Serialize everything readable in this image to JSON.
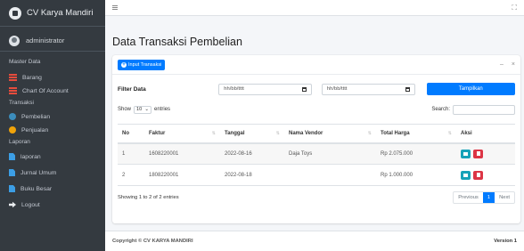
{
  "sidebar": {
    "brand": "CV Karya Mandiri",
    "user": "administrator",
    "sections": [
      {
        "header": "Master Data",
        "items": [
          {
            "label": "Barang",
            "icon": "table-icon"
          },
          {
            "label": "Chart Of Account",
            "icon": "table-icon"
          }
        ]
      },
      {
        "header": "Transaksi",
        "items": [
          {
            "label": "Pembelian",
            "icon": "circle-icon"
          },
          {
            "label": "Penjualan",
            "icon": "circle-icon"
          }
        ]
      },
      {
        "header": "Laporan",
        "items": [
          {
            "label": "laporan",
            "icon": "file-icon"
          },
          {
            "label": "Jurnal Umum",
            "icon": "file-icon"
          },
          {
            "label": "Buku Besar",
            "icon": "file-icon"
          }
        ]
      }
    ],
    "logout": "Logout"
  },
  "header": {
    "title": "Data Transaksi Pembelian"
  },
  "card": {
    "add_button": "Input Transaksi",
    "tools": {
      "minimize": "–",
      "close": "×"
    },
    "filter": {
      "label": "Filter Data",
      "date_placeholder": "hh/bb/tttt",
      "button": "Tampilkan"
    },
    "length": {
      "prefix": "Show",
      "value": "10",
      "suffix": "entries"
    },
    "search_label": "Search:",
    "table": {
      "headers": [
        "No",
        "Faktur",
        "Tanggal",
        "Nama Vendor",
        "Total Harga",
        "Aksi"
      ],
      "rows": [
        {
          "no": "1",
          "faktur": "1608220001",
          "tanggal": "2022-08-16",
          "vendor": "Daja Toys",
          "total": "Rp 2.075.000"
        },
        {
          "no": "2",
          "faktur": "1808220001",
          "tanggal": "2022-08-18",
          "vendor": "",
          "total": "Rp 1.000.000"
        }
      ]
    },
    "info": "Showing 1 to 2 of 2 entries",
    "pager": {
      "prev": "Previous",
      "current": "1",
      "next": "Next"
    }
  },
  "footer": {
    "copyright": "Copyright © CV KARYA MANDIRI",
    "version": "Version 1"
  },
  "colors": {
    "sidebar": "#343a40",
    "primary": "#007bff",
    "info": "#17a2b8",
    "danger": "#dc3545"
  }
}
